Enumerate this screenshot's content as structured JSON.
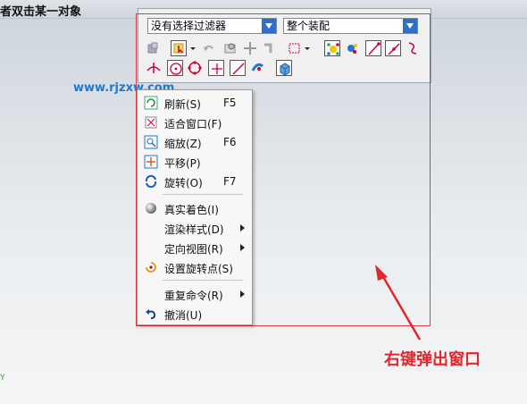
{
  "window": {
    "title": "者双击某一对象"
  },
  "selection_bar": {
    "filter_value": "没有选择过滤器",
    "scope_value": "整个装配"
  },
  "watermark": "www.rjzxw.com",
  "context_menu": {
    "items": [
      {
        "label": "刷新(S)",
        "shortcut": "F5"
      },
      {
        "label": "适合窗口(F)",
        "shortcut": ""
      },
      {
        "label": "缩放(Z)",
        "shortcut": "F6"
      },
      {
        "label": "平移(P)",
        "shortcut": ""
      },
      {
        "label": "旋转(O)",
        "shortcut": "F7"
      },
      {
        "label": "真实着色(I)",
        "shortcut": ""
      },
      {
        "label": "渲染样式(D)",
        "shortcut": ""
      },
      {
        "label": "定向视图(R)",
        "shortcut": ""
      },
      {
        "label": "设置旋转点(S)",
        "shortcut": ""
      },
      {
        "label": "重复命令(R)",
        "shortcut": ""
      },
      {
        "label": "撤消(U)",
        "shortcut": ""
      }
    ]
  },
  "annotation": {
    "text": "右键弹出窗口",
    "color": "#e0282c"
  },
  "corner_text": "Y",
  "colors": {
    "accent": "#2f6fc7",
    "highlight_red": "#e03a3a"
  }
}
